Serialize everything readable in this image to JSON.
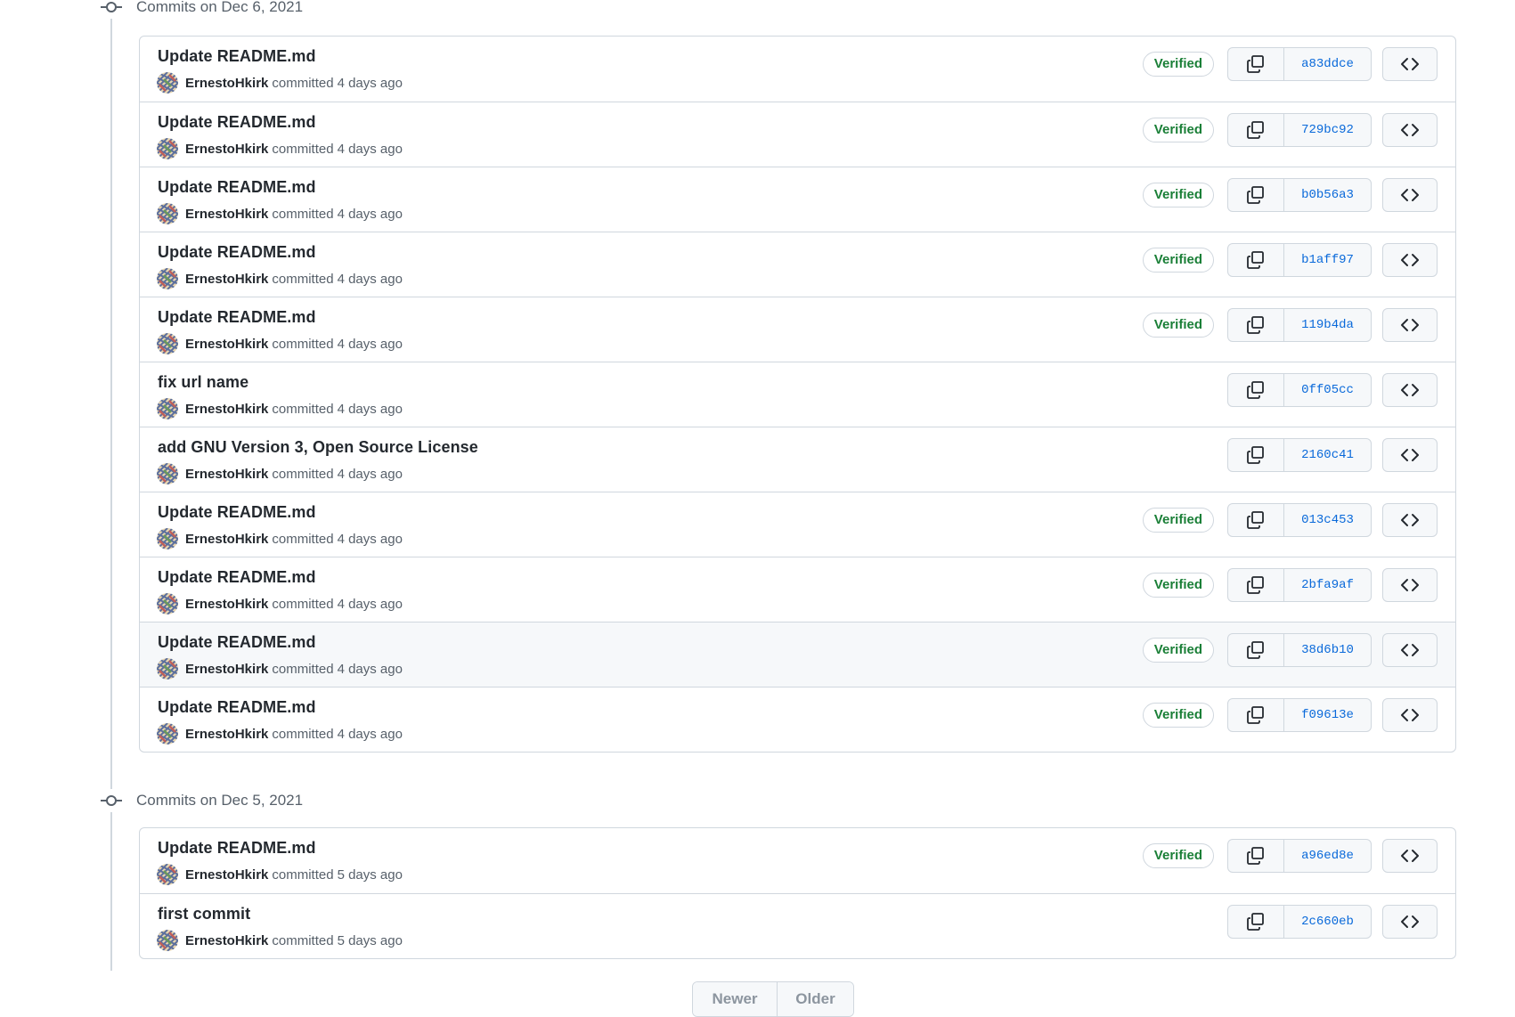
{
  "groups": [
    {
      "title": "Commits on Dec 6, 2021",
      "commits": [
        {
          "message": "Update README.md",
          "author": "ErnestoHkirk",
          "verb": "committed",
          "time": "4 days ago",
          "verified": "Verified",
          "sha": "a83ddce"
        },
        {
          "message": "Update README.md",
          "author": "ErnestoHkirk",
          "verb": "committed",
          "time": "4 days ago",
          "verified": "Verified",
          "sha": "729bc92"
        },
        {
          "message": "Update README.md",
          "author": "ErnestoHkirk",
          "verb": "committed",
          "time": "4 days ago",
          "verified": "Verified",
          "sha": "b0b56a3"
        },
        {
          "message": "Update README.md",
          "author": "ErnestoHkirk",
          "verb": "committed",
          "time": "4 days ago",
          "verified": "Verified",
          "sha": "b1aff97"
        },
        {
          "message": "Update README.md",
          "author": "ErnestoHkirk",
          "verb": "committed",
          "time": "4 days ago",
          "verified": "Verified",
          "sha": "119b4da"
        },
        {
          "message": "fix url name",
          "author": "ErnestoHkirk",
          "verb": "committed",
          "time": "4 days ago",
          "verified": null,
          "sha": "0ff05cc"
        },
        {
          "message": "add GNU Version 3, Open Source License",
          "author": "ErnestoHkirk",
          "verb": "committed",
          "time": "4 days ago",
          "verified": null,
          "sha": "2160c41"
        },
        {
          "message": "Update README.md",
          "author": "ErnestoHkirk",
          "verb": "committed",
          "time": "4 days ago",
          "verified": "Verified",
          "sha": "013c453"
        },
        {
          "message": "Update README.md",
          "author": "ErnestoHkirk",
          "verb": "committed",
          "time": "4 days ago",
          "verified": "Verified",
          "sha": "2bfa9af"
        },
        {
          "message": "Update README.md",
          "author": "ErnestoHkirk",
          "verb": "committed",
          "time": "4 days ago",
          "verified": "Verified",
          "sha": "38d6b10",
          "highlighted": true
        },
        {
          "message": "Update README.md",
          "author": "ErnestoHkirk",
          "verb": "committed",
          "time": "4 days ago",
          "verified": "Verified",
          "sha": "f09613e"
        }
      ]
    },
    {
      "title": "Commits on Dec 5, 2021",
      "commits": [
        {
          "message": "Update README.md",
          "author": "ErnestoHkirk",
          "verb": "committed",
          "time": "5 days ago",
          "verified": "Verified",
          "sha": "a96ed8e"
        },
        {
          "message": "first commit",
          "author": "ErnestoHkirk",
          "verb": "committed",
          "time": "5 days ago",
          "verified": null,
          "sha": "2c660eb"
        }
      ]
    }
  ],
  "pagination": {
    "newer_label": "Newer",
    "older_label": "Older"
  },
  "icons": {
    "timeline": "git-commit-icon",
    "copy": "copy-icon",
    "browse": "code-icon",
    "avatar": "identicon-avatar"
  },
  "colors": {
    "verified": "#1a7f37",
    "sha_link": "#0969da",
    "muted": "#57606a",
    "border": "#d0d7de"
  }
}
